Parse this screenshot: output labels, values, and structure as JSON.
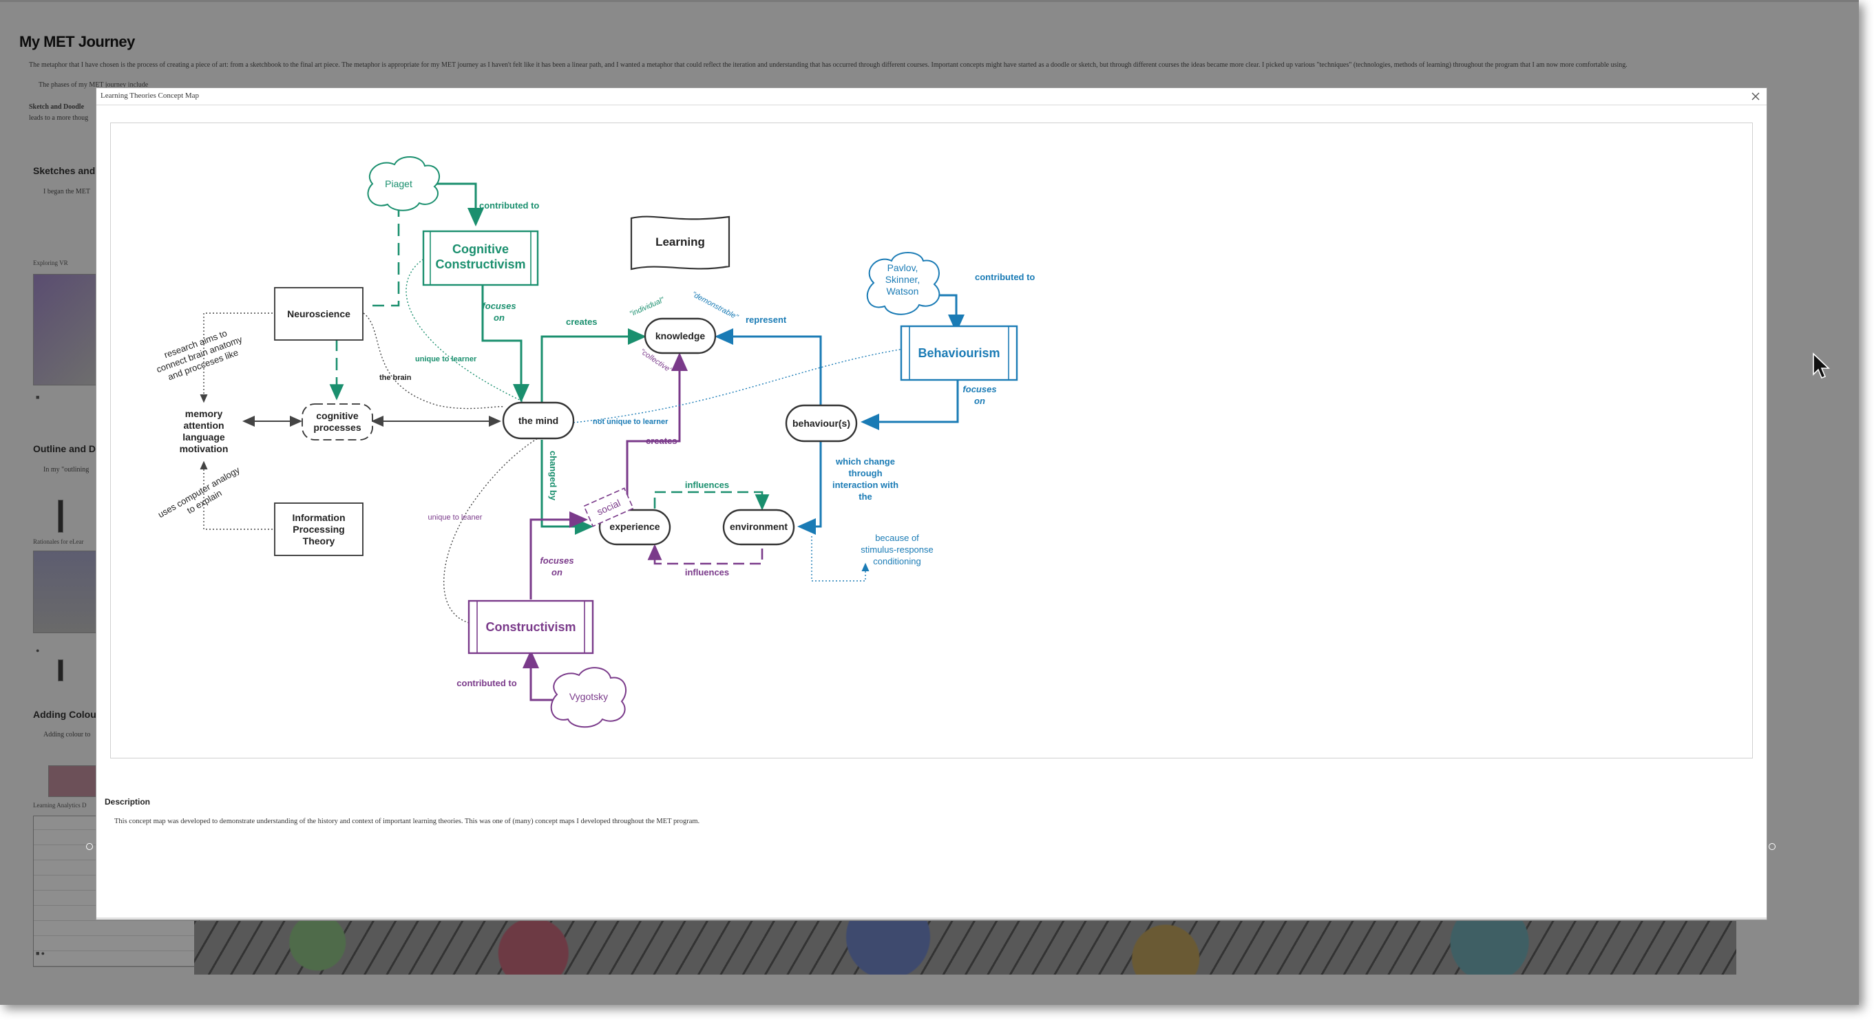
{
  "page": {
    "title": "My MET Journey",
    "intro": "The metaphor that I have chosen is the process of creating a piece of art: from a sketchbook to the final art piece. The metaphor is appropriate for my MET journey as I haven't felt like it has been a linear path, and I wanted a metaphor that could reflect the iteration and understanding that has occurred through different courses. Important concepts might have started as a doodle or sketch, but through different courses the ideas became more clear. I picked up various \"techniques\" (technologies, methods of learning) throughout the program that I am now more comfortable using.",
    "phases_line": "The phases of my MET journey include",
    "sketch_bold": "Sketch and Doodle",
    "leads_to": "leads to a more thoug",
    "section_sketches": "Sketches and",
    "sketches_text": "I began the MET",
    "exploring_vr": "Exploring VR",
    "section_outline": "Outline and D",
    "outline_text": "In my \"outlining",
    "rationales": "Rationales for eLear",
    "section_colour": "Adding Colou",
    "colour_text": "Adding colour to",
    "learning_analytics": "Learning Analytics D"
  },
  "modal": {
    "title": "Learning Theories Concept Map",
    "close_label": "×",
    "description_heading": "Description",
    "description": "This concept map was developed to demonstrate understanding of the history and context of important learning theories. This was one of (many) concept maps I developed throughout the MET program."
  },
  "colors": {
    "green": "#1a8f6e",
    "blue": "#1a7bb5",
    "purple": "#7a3a8a",
    "dark": "#333333",
    "overlay": "#8a8a8a"
  },
  "concept_map": {
    "nodes": {
      "learning": "Learning",
      "piaget": "Piaget",
      "cognitive_constructivism_1": "Cognitive",
      "cognitive_constructivism_2": "Constructivism",
      "neuroscience": "Neuroscience",
      "knowledge": "knowledge",
      "the_mind": "the mind",
      "cognitive_processes_1": "cognitive",
      "cognitive_processes_2": "processes",
      "memory_1": "memory",
      "memory_2": "attention",
      "memory_3": "language",
      "memory_4": "motivation",
      "ipt_1": "Information",
      "ipt_2": "Processing",
      "ipt_3": "Theory",
      "experience": "experience",
      "environment": "environment",
      "behaviours": "behaviour(s)",
      "behaviourism": "Behaviourism",
      "pavlov_1": "Pavlov,",
      "pavlov_2": "Skinner,",
      "pavlov_3": "Watson",
      "constructivism": "Constructivism",
      "vygotsky": "Vygotsky",
      "social": "social"
    },
    "labels": {
      "contributed_to": "contributed to",
      "focuses": "focuses",
      "on": "on",
      "creates": "creates",
      "represent": "represent",
      "unique_to_learner": "unique to  learner",
      "the_brain": "the brain",
      "research_1": "research aims to",
      "research_2": "connect brain anatomy",
      "research_3": "and procceses like",
      "uses_1": "uses computer analogy",
      "uses_2": "to explain",
      "not_unique": "not unique to learner",
      "changed_by": "changed by",
      "influences": "influences",
      "which_1": "which change",
      "which_2": "through",
      "which_3": "interaction with",
      "which_4": "the",
      "because_1": "because of",
      "because_2": "stimulus-response",
      "because_3": "conditioning",
      "unique_to_leaner": "unique to leaner",
      "individual": "\"individual\"",
      "demonstrable": "\"demonstrable\"",
      "collective": "\"collective\""
    }
  }
}
